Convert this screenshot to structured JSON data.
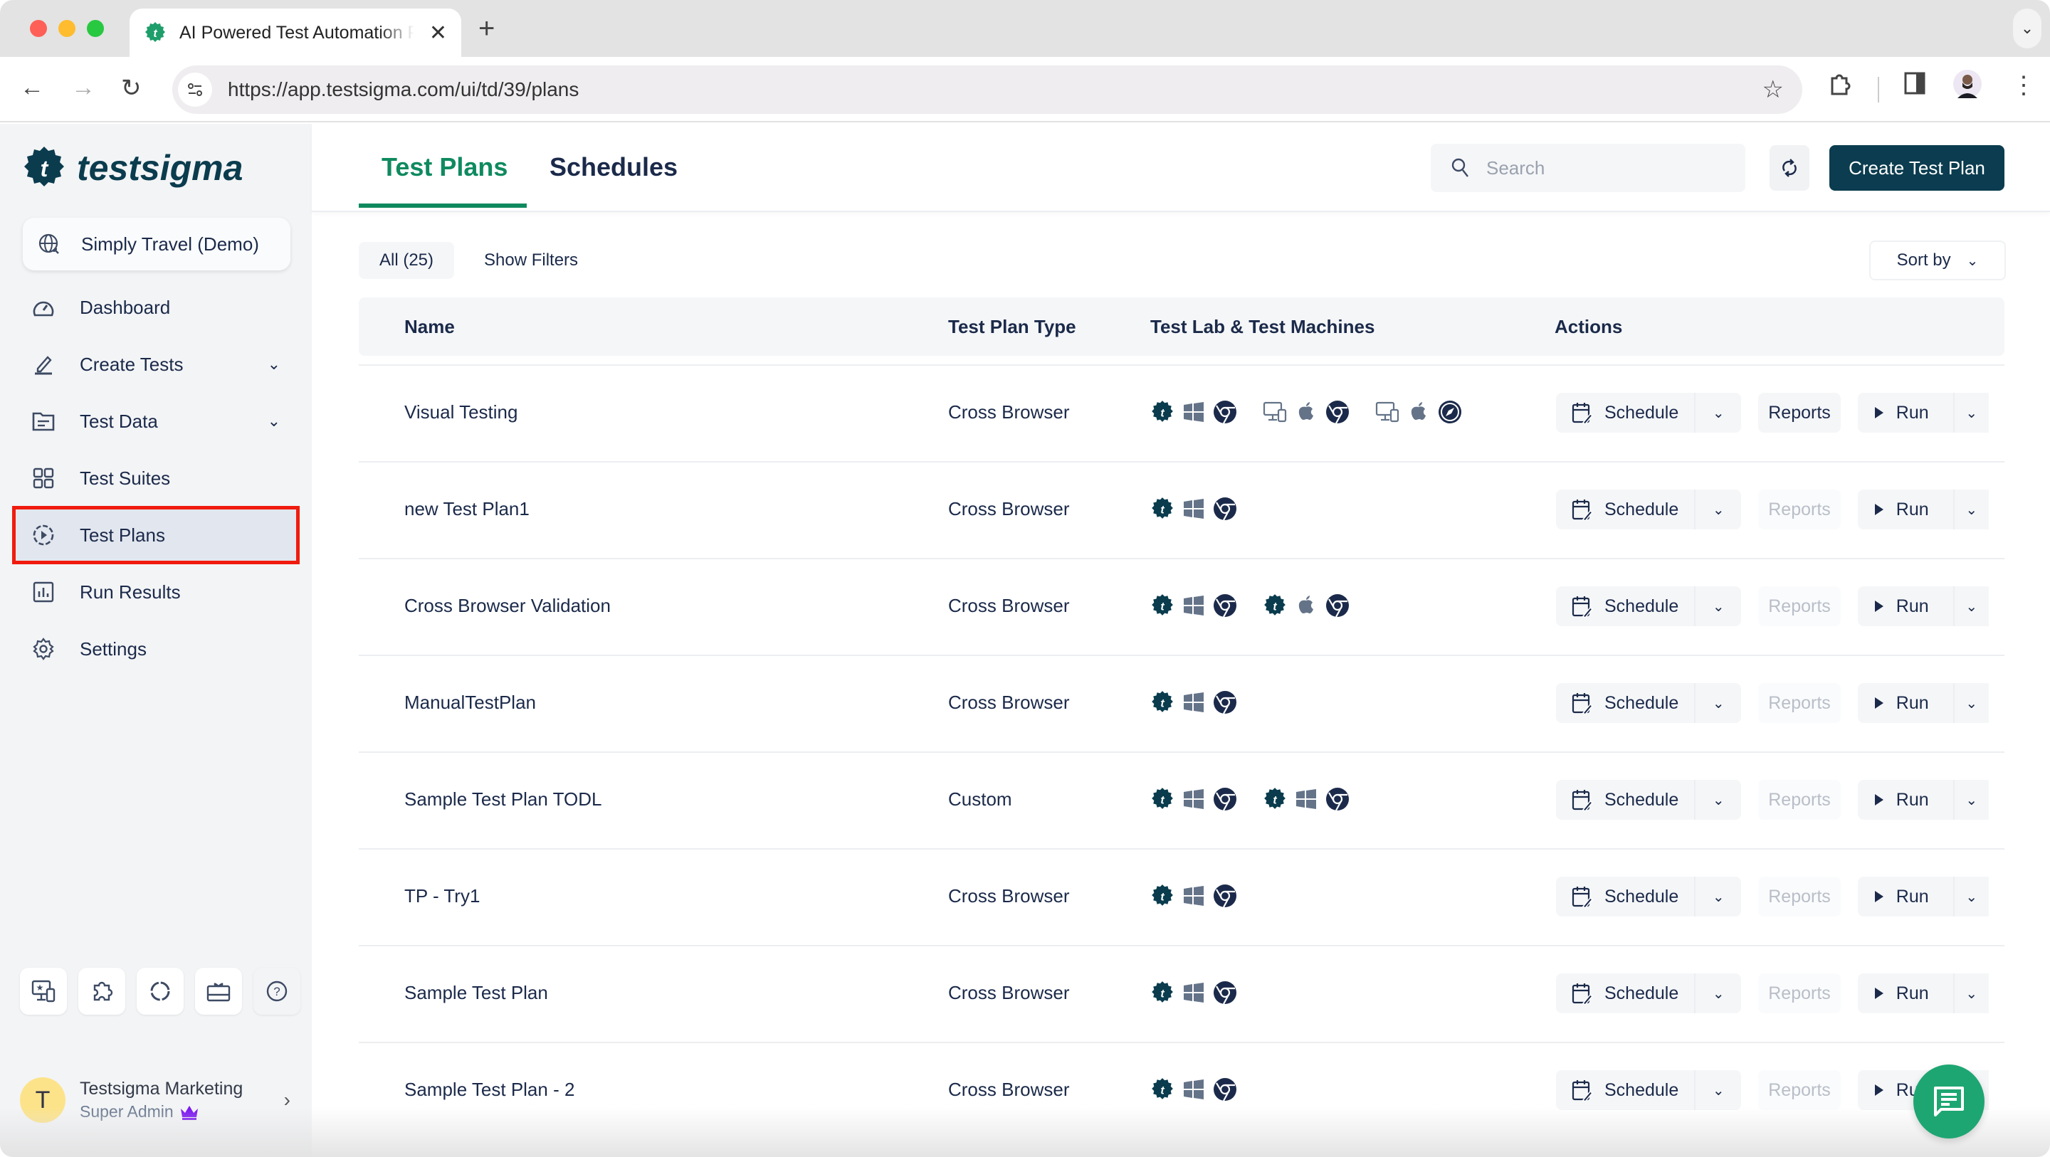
{
  "browser": {
    "tab_title": "AI Powered Test Automation Platform",
    "url": "https://app.testsigma.com/ui/td/39/plans"
  },
  "sidebar": {
    "logo_text": "testsigma",
    "project": "Simply Travel (Demo)",
    "items": [
      {
        "label": "Dashboard",
        "icon": "dashboard-icon",
        "expandable": false
      },
      {
        "label": "Create Tests",
        "icon": "pencil-icon",
        "expandable": true
      },
      {
        "label": "Test Data",
        "icon": "folder-icon",
        "expandable": true
      },
      {
        "label": "Test Suites",
        "icon": "grid-icon",
        "expandable": false
      },
      {
        "label": "Test Plans",
        "icon": "play-circle-icon",
        "expandable": false,
        "active": true
      },
      {
        "label": "Run Results",
        "icon": "bar-chart-icon",
        "expandable": false
      },
      {
        "label": "Settings",
        "icon": "gear-icon",
        "expandable": false
      }
    ],
    "utility_icons": [
      "devices-star-icon",
      "puzzle-icon",
      "loader-circle-icon",
      "gift-card-icon",
      "help-icon"
    ],
    "user": {
      "initial": "T",
      "name": "Testsigma Marketing",
      "role": "Super Admin"
    }
  },
  "header": {
    "tabs": [
      {
        "label": "Test Plans",
        "active": true
      },
      {
        "label": "Schedules",
        "active": false
      }
    ],
    "search_placeholder": "Search",
    "create_button": "Create Test Plan"
  },
  "filters": {
    "all_label": "All (25)",
    "show_filters": "Show Filters",
    "sort_by": "Sort by"
  },
  "table": {
    "columns": [
      "Name",
      "Test Plan Type",
      "Test Lab & Test Machines",
      "Actions"
    ],
    "action_labels": {
      "schedule": "Schedule",
      "reports": "Reports",
      "run": "Run"
    },
    "rows": [
      {
        "name": "Visual Testing",
        "type": "Cross Browser",
        "reports_enabled": true,
        "machines": [
          [
            "testsigma-lab",
            "windows",
            "chrome"
          ],
          [
            "desktop-mobile",
            "apple",
            "chrome"
          ],
          [
            "desktop-mobile",
            "apple",
            "safari"
          ]
        ]
      },
      {
        "name": "new Test Plan1",
        "type": "Cross Browser",
        "reports_enabled": false,
        "machines": [
          [
            "testsigma-lab",
            "windows",
            "chrome"
          ]
        ]
      },
      {
        "name": "Cross Browser Validation",
        "type": "Cross Browser",
        "reports_enabled": false,
        "machines": [
          [
            "testsigma-lab",
            "windows",
            "chrome"
          ],
          [
            "testsigma-lab",
            "apple",
            "chrome"
          ]
        ]
      },
      {
        "name": "ManualTestPlan",
        "type": "Cross Browser",
        "reports_enabled": false,
        "machines": [
          [
            "testsigma-lab",
            "windows",
            "chrome"
          ]
        ]
      },
      {
        "name": "Sample Test Plan TODL",
        "type": "Custom",
        "reports_enabled": false,
        "machines": [
          [
            "testsigma-lab",
            "windows",
            "chrome"
          ],
          [
            "testsigma-lab",
            "windows",
            "chrome"
          ]
        ]
      },
      {
        "name": "TP - Try1",
        "type": "Cross Browser",
        "reports_enabled": false,
        "machines": [
          [
            "testsigma-lab",
            "windows",
            "chrome"
          ]
        ]
      },
      {
        "name": "Sample Test Plan",
        "type": "Cross Browser",
        "reports_enabled": false,
        "machines": [
          [
            "testsigma-lab",
            "windows",
            "chrome"
          ]
        ]
      },
      {
        "name": "Sample Test Plan - 2",
        "type": "Cross Browser",
        "reports_enabled": false,
        "machines": [
          [
            "testsigma-lab",
            "windows",
            "chrome"
          ]
        ]
      }
    ]
  },
  "colors": {
    "brand_green": "#0f8a5f",
    "primary_dark": "#0b3c4f",
    "highlight_red": "#f01b0f",
    "chat_green": "#1ea672",
    "crown_purple": "#7a14f0"
  }
}
